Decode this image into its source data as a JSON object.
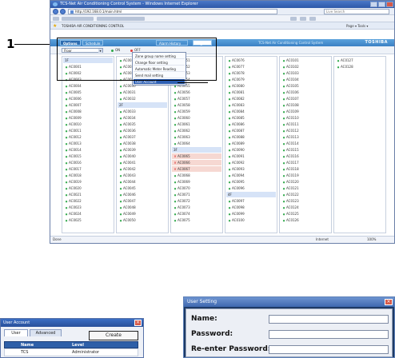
{
  "browser": {
    "title": "TCS-Net Air Conditioning Control System - Windows Internet Explorer",
    "url": "http://192.168.0.1/main.html",
    "search_placeholder": "Live Search",
    "tab_title": "TOSHIBA AIR CONDITIONING CONTROL",
    "toolbar_right": "Page ▾  Tools ▾",
    "status_left": "Done",
    "status_zone": "Internet",
    "status_zoom": "100%"
  },
  "app": {
    "menus": {
      "options": "Options",
      "schedule": "Schedule",
      "alarm": "Alarm History",
      "logoff": "Log off"
    },
    "app_title": "TCS-Net Air Conditioning Control System",
    "brand": "TOSHIBA",
    "floor_select": "Floor",
    "legend": {
      "on": "ON",
      "off": "OFF",
      "err": "Alarm"
    },
    "dropdown": [
      "Zone group name setting",
      "Change floor setting",
      "Automatic Meter Reading",
      "Send mail setting",
      "User Account"
    ],
    "columns": [
      [
        "1F",
        "AC0001",
        "AC0002",
        "AC0003",
        "AC0004",
        "AC0005",
        "AC0006",
        "AC0007",
        "AC0008",
        "AC0009",
        "AC0010",
        "AC0011",
        "AC0012",
        "AC0013",
        "AC0014",
        "AC0015",
        "AC0016",
        "AC0017",
        "AC0018",
        "AC0019",
        "AC0020",
        "AC0021",
        "AC0022",
        "AC0023",
        "AC0024",
        "AC0025"
      ],
      [
        "AC0026",
        "AC0027",
        "AC0028",
        "AC0029",
        "AC0030",
        "AC0031",
        "AC0032",
        "2F",
        "AC0033",
        "AC0034",
        "AC0035",
        "AC0036",
        "AC0037",
        "AC0038",
        "AC0039",
        "AC0040",
        "AC0041",
        "AC0042",
        "AC0043",
        "AC0044",
        "AC0045",
        "AC0046",
        "AC0047",
        "AC0048",
        "AC0049",
        "AC0050"
      ],
      [
        "AC0051",
        "AC0052",
        "AC0053",
        "AC0054",
        "AC0055",
        "AC0056",
        "AC0057",
        "AC0058",
        "AC0059",
        "AC0060",
        "AC0061",
        "AC0062",
        "AC0063",
        "AC0064",
        "3F",
        "AC0065",
        "AC0066",
        "AC0067",
        "AC0068",
        "AC0069",
        "AC0070",
        "AC0071",
        "AC0072",
        "AC0073",
        "AC0074",
        "AC0075"
      ],
      [
        "AC0076",
        "AC0077",
        "AC0078",
        "AC0079",
        "AC0080",
        "AC0081",
        "AC0082",
        "AC0083",
        "AC0084",
        "AC0085",
        "AC0086",
        "AC0087",
        "AC0088",
        "AC0089",
        "AC0090",
        "AC0091",
        "AC0092",
        "AC0093",
        "AC0094",
        "AC0095",
        "AC0096",
        "4F",
        "AC0097",
        "AC0098",
        "AC0099",
        "AC0100"
      ],
      [
        "AC0101",
        "AC0102",
        "AC0103",
        "AC0104",
        "AC0105",
        "AC0106",
        "AC0107",
        "AC0108",
        "AC0109",
        "AC0110",
        "AC0111",
        "AC0112",
        "AC0113",
        "AC0114",
        "AC0115",
        "AC0116",
        "AC0117",
        "AC0118",
        "AC0119",
        "AC0120",
        "AC0121",
        "AC0122",
        "AC0123",
        "AC0124",
        "AC0125",
        "AC0126"
      ],
      [
        "AC0127",
        "AC0128"
      ]
    ],
    "error_units": [
      "AC0065",
      "AC0066",
      "AC0067"
    ],
    "colors": {
      "on": "#2fa84a",
      "off": "#e03a3a",
      "floor_bg": "#d6e3f7",
      "header": "#3b80c4"
    }
  },
  "callout": {
    "number": "1"
  },
  "user_account": {
    "title": "User Account",
    "tabs": [
      "User",
      "Advanced"
    ],
    "create_label": "Create",
    "headers": [
      "Name",
      "Level"
    ],
    "row": [
      "TCS",
      "Administrator"
    ]
  },
  "user_setting": {
    "title": "User Setting",
    "name_label": "Name:",
    "password_label": "Password:",
    "reenter_label": "Re-enter Password:"
  }
}
